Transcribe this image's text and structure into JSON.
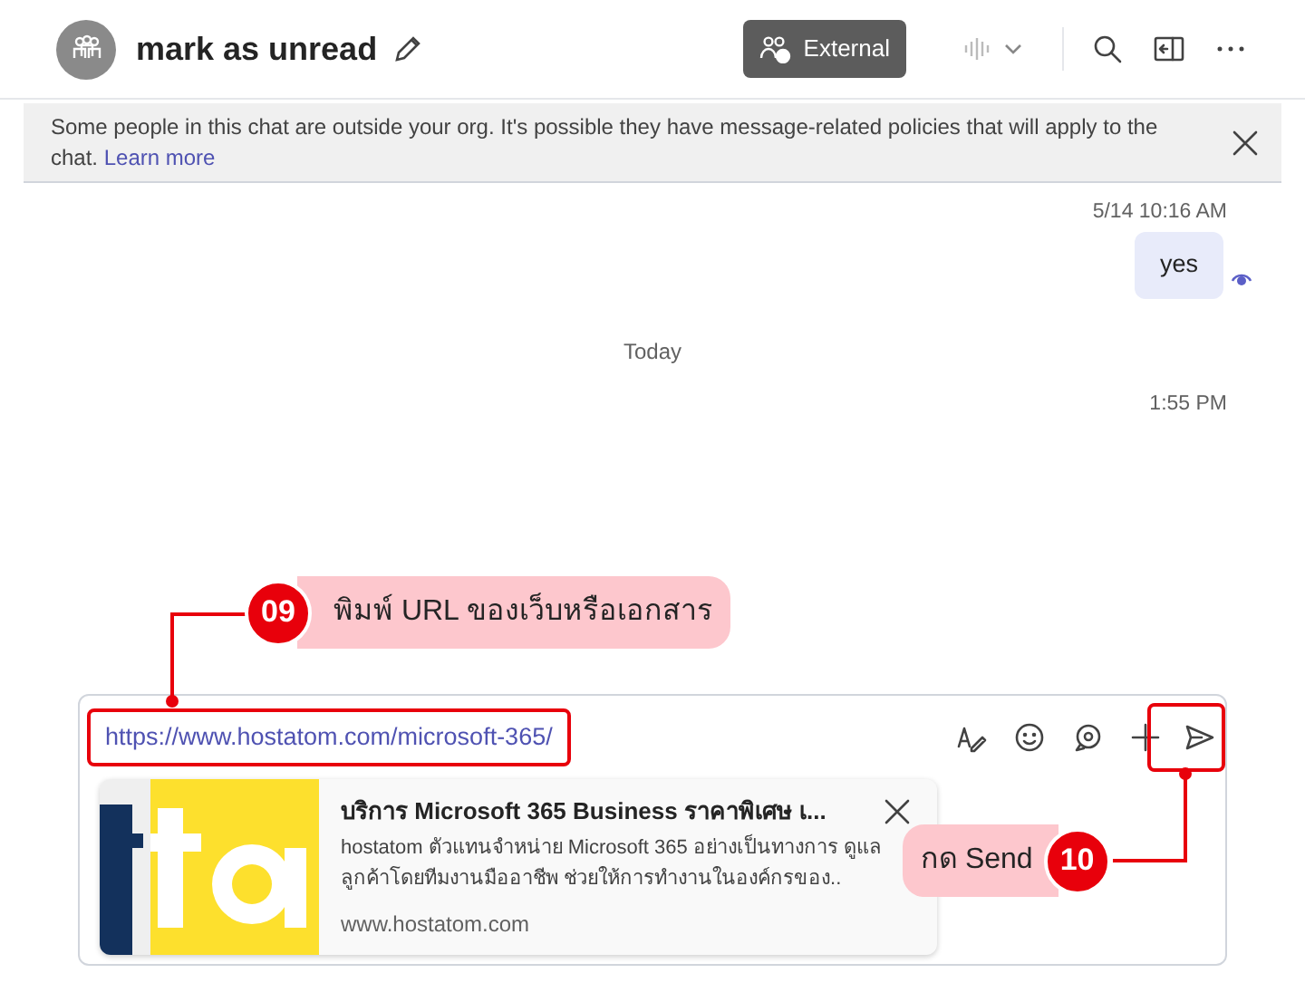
{
  "header": {
    "title": "mark as unread",
    "external_button": "External"
  },
  "banner": {
    "text": "Some people in this chat are outside your org. It's possible they have message-related policies that will apply to the chat.",
    "link": "Learn more"
  },
  "messages": [
    {
      "kind": "timestamp",
      "text": "5/14 10:16 AM"
    },
    {
      "kind": "bubble",
      "text": "yes",
      "seen": true
    },
    {
      "kind": "divider",
      "text": "Today"
    },
    {
      "kind": "timestamp",
      "text": "1:55 PM"
    }
  ],
  "composer": {
    "value": "https://www.hostatom.com/microsoft-365/",
    "preview": {
      "kind": "picture",
      "title": "บริการ Microsoft 365 Business ราคาพิเศษ เ...",
      "description": "hostatom ตัวแทนจำหน่าย Microsoft 365 อย่างเป็นทางการ ดูแลลูกค้าโดยทีมงานมืออาชีพ ช่วยให้การทำงานในองค์กรของ..",
      "domain": "www.hostatom.com"
    }
  },
  "annotations": [
    {
      "number": "09",
      "text": "พิมพ์ URL ของเว็บหรือเอกสาร"
    },
    {
      "number": "10",
      "text": "กด Send"
    }
  ]
}
